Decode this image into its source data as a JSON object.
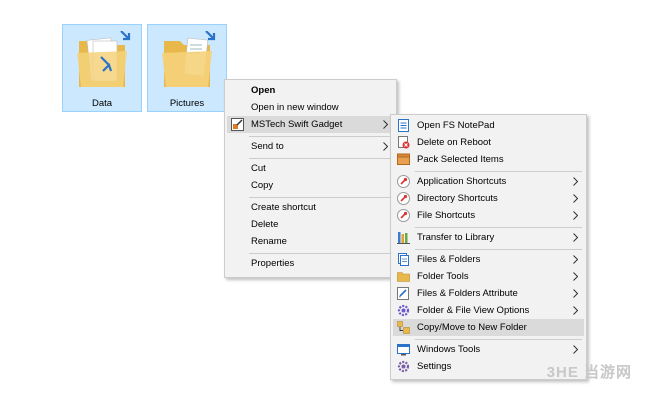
{
  "desktop": {
    "items": [
      {
        "label": "Data"
      },
      {
        "label": "Pictures"
      }
    ]
  },
  "context_menu": {
    "items": [
      {
        "label": "Open"
      },
      {
        "label": "Open in new window"
      },
      {
        "label": "MSTech Swift Gadget"
      },
      {
        "label": "Send to"
      },
      {
        "label": "Cut"
      },
      {
        "label": "Copy"
      },
      {
        "label": "Create shortcut"
      },
      {
        "label": "Delete"
      },
      {
        "label": "Rename"
      },
      {
        "label": "Properties"
      }
    ]
  },
  "submenu": {
    "items": [
      {
        "label": "Open FS NotePad",
        "icon": "notepad-icon"
      },
      {
        "label": "Delete on Reboot",
        "icon": "delete-reboot-icon"
      },
      {
        "label": "Pack Selected Items",
        "icon": "pack-icon"
      },
      {
        "label": "Application Shortcuts",
        "icon": "pin-icon"
      },
      {
        "label": "Directory Shortcuts",
        "icon": "pin-icon"
      },
      {
        "label": "File Shortcuts",
        "icon": "pin-icon"
      },
      {
        "label": "Transfer to Library",
        "icon": "library-icon"
      },
      {
        "label": "Files & Folders",
        "icon": "files-icon"
      },
      {
        "label": "Folder Tools",
        "icon": "folder-icon"
      },
      {
        "label": "Files & Folders Attribute",
        "icon": "attribute-icon"
      },
      {
        "label": "Folder & File View Options",
        "icon": "gear-icon"
      },
      {
        "label": "Copy/Move to New Folder",
        "icon": "copy-move-icon"
      },
      {
        "label": "Windows Tools",
        "icon": "windows-tools-icon"
      },
      {
        "label": "Settings",
        "icon": "settings-icon"
      }
    ]
  },
  "watermark": "3HE 当游网",
  "colors": {
    "selection": "#cce8ff",
    "menu_bg": "#f2f2f2",
    "highlight": "#dadada"
  }
}
